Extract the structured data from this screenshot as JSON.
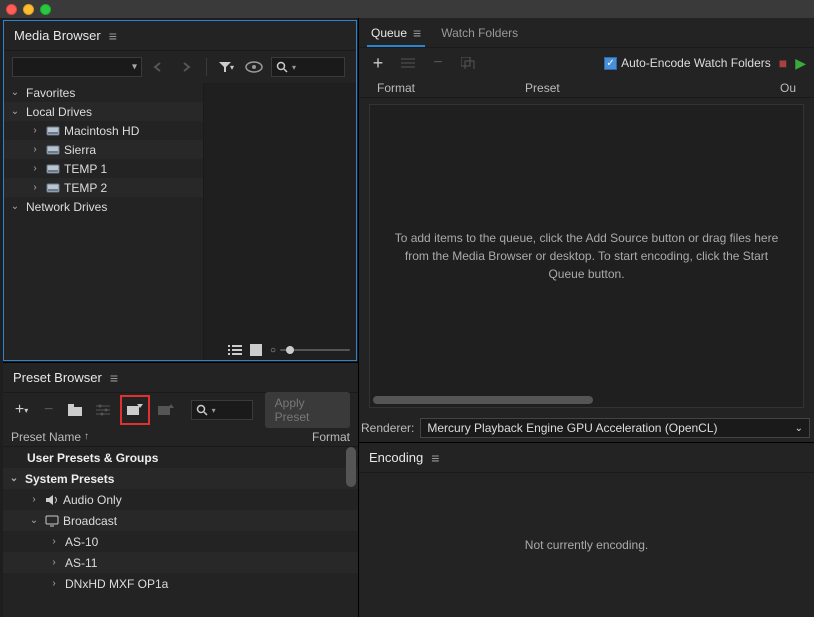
{
  "panels": {
    "mediaBrowser": {
      "title": "Media Browser"
    },
    "presetBrowser": {
      "title": "Preset Browser"
    },
    "queue": {
      "title": "Queue"
    },
    "watchFolders": {
      "title": "Watch Folders"
    },
    "encoding": {
      "title": "Encoding"
    }
  },
  "mediaBrowser": {
    "tree": {
      "favorites": "Favorites",
      "localDrives": "Local Drives",
      "networkDrives": "Network Drives",
      "drives": [
        {
          "label": "Macintosh HD"
        },
        {
          "label": "Sierra"
        },
        {
          "label": "TEMP 1"
        },
        {
          "label": "TEMP 2"
        }
      ]
    }
  },
  "presetBrowser": {
    "applyLabel": "Apply Preset",
    "columns": {
      "name": "Preset Name",
      "format": "Format"
    },
    "groups": {
      "userPresets": "User Presets & Groups",
      "systemPresets": "System Presets"
    },
    "items": {
      "audioOnly": "Audio Only",
      "broadcast": "Broadcast",
      "as10": "AS-10",
      "as11": "AS-11",
      "dnxhd": "DNxHD MXF OP1a"
    }
  },
  "queue": {
    "autoEncode": "Auto-Encode Watch Folders",
    "columns": {
      "format": "Format",
      "preset": "Preset",
      "output": "Ou"
    },
    "emptyMessage": "To add items to the queue, click the Add Source button or drag files here from the Media Browser or desktop.  To start encoding, click the Start Queue button.",
    "rendererLabel": "Renderer:",
    "rendererValue": "Mercury Playback Engine GPU Acceleration (OpenCL)"
  },
  "encoding": {
    "emptyMessage": "Not currently encoding."
  }
}
